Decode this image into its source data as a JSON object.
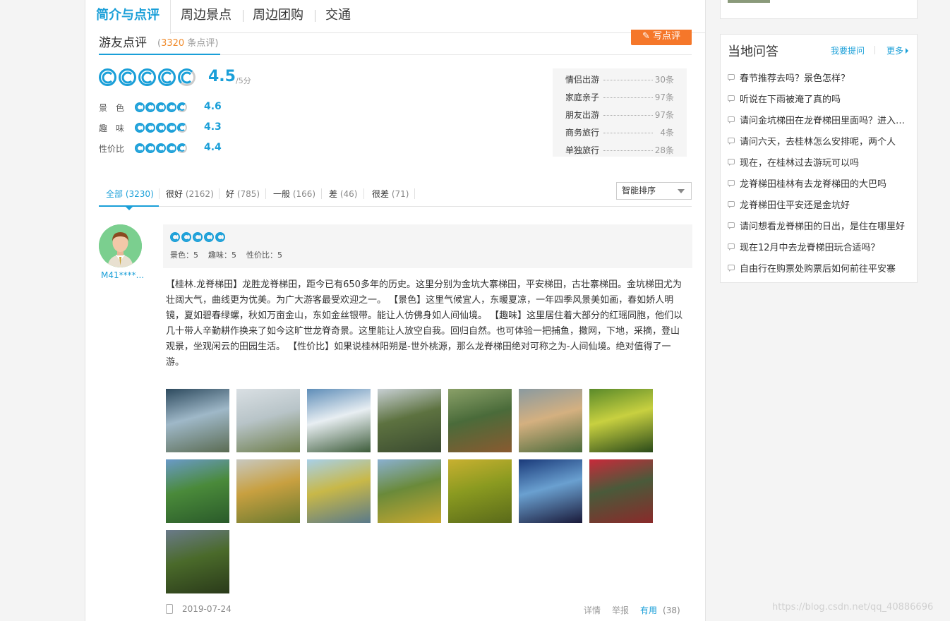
{
  "nav_tabs": [
    "简介与点评",
    "周边景点",
    "周边团购",
    "交通"
  ],
  "review_header": {
    "title": "游友点评",
    "count_open": "(",
    "count": "3320",
    "count_suffix": "条点评)",
    "write_button": "写点评"
  },
  "overall": {
    "score": "4.5",
    "unit": "/5分",
    "stars": 4.5
  },
  "sub_ratings": [
    {
      "label": "景　色",
      "score": "4.6"
    },
    {
      "label": "趣　味",
      "score": "4.3"
    },
    {
      "label": "性价比",
      "score": "4.4"
    }
  ],
  "trip_types": [
    {
      "label": "情侣出游",
      "count": "30条"
    },
    {
      "label": "家庭亲子",
      "count": "97条"
    },
    {
      "label": "朋友出游",
      "count": "97条"
    },
    {
      "label": "商务旅行",
      "count": "4条"
    },
    {
      "label": "单独旅行",
      "count": "28条"
    }
  ],
  "filters": [
    {
      "label": "全部",
      "count": "(3230)"
    },
    {
      "label": "很好",
      "count": "(2162)"
    },
    {
      "label": "好",
      "count": "(785)"
    },
    {
      "label": "一般",
      "count": "(166)"
    },
    {
      "label": "差",
      "count": "(46)"
    },
    {
      "label": "很差",
      "count": "(71)"
    }
  ],
  "sort": {
    "selected": "智能排序"
  },
  "review": {
    "user": "M41****...",
    "stars": 5,
    "detail": [
      "景色：5",
      "趣味：5",
      "性价比：5"
    ],
    "text": "【桂林.龙脊梯田】龙胜龙脊梯田，距今已有650多年的历史。这里分别为金坑大寨梯田，平安梯田，古壮寨梯田。金坑梯田尤为壮阔大气，曲线更为优美。为广大游客最受欢迎之一。 【景色】这里气候宜人，东暖夏凉，一年四季风景美如画，春如娇人明镜，夏如碧春绿螺，秋如万亩金山，东如金丝银带。能让人仿佛身如人间仙境。 【趣味】这里居住着大部分的红瑶同胞，他们以几十带人辛勤耕作换来了如今这旷世龙脊奇景。这里能让人放空自我。回归自然。也可体验一把捕鱼，撒网，下地，采摘，登山观景，坐观闲云的田园生活。 【性价比】如果说桂林阳朔是-世外桃源，那么龙脊梯田绝对可称之为-人间仙境。绝对值得了一游。",
    "date": "2019-07-24",
    "actions": {
      "detail": "详情",
      "report": "举报",
      "useful": "有用",
      "useful_count": "(38)"
    }
  },
  "photo_colors": [
    [
      "#2d4a5e",
      "#9fb8c8",
      "#5a6b52"
    ],
    [
      "#d9dfe3",
      "#b8c4c8",
      "#6d7d4a"
    ],
    [
      "#5e8db8",
      "#e8eef2",
      "#3d5c3a"
    ],
    [
      "#c8d0d4",
      "#5d7240",
      "#3a4a30"
    ],
    [
      "#8aa068",
      "#4a6b3a",
      "#8a5a30"
    ],
    [
      "#8a9aa0",
      "#d4b080",
      "#4a6a3a"
    ],
    [
      "#5a8a2a",
      "#c8d040",
      "#2a4a1a"
    ],
    [
      "#6a9ac8",
      "#4a8a3a",
      "#2a5a2a"
    ],
    [
      "#c8c8c0",
      "#c8a040",
      "#6a7a30"
    ],
    [
      "#a8d0e8",
      "#c8b848",
      "#5a7a8a"
    ],
    [
      "#8ab0d0",
      "#6a8a3a",
      "#c8a830"
    ],
    [
      "#c8b030",
      "#8a9a20",
      "#5a6a1a"
    ],
    [
      "#1a3a7a",
      "#6aa0d0",
      "#1a1a3a"
    ],
    [
      "#c82a3a",
      "#4a5a3a",
      "#8a2a2a"
    ],
    [
      "#6a7a8a",
      "#4a6a2a",
      "#2a3a1a"
    ]
  ],
  "qa": {
    "title": "当地问答",
    "ask": "我要提问",
    "more": "更多",
    "items": [
      "春节推荐去吗？景色怎样？",
      "听说在下雨被淹了真的吗",
      "请问金坑梯田在龙脊梯田里面吗？进入梯田需要收费吗",
      "请问六天，去桂林怎么安排呢，两个人",
      "现在，在桂林过去游玩可以吗",
      "龙脊梯田桂林有去龙脊梯田的大巴吗",
      "龙脊梯田住平安还是金坑好",
      "请问想看龙脊梯田的日出，是住在哪里好",
      "现在12月中去龙脊梯田玩合适吗？",
      "自由行在购票处购票后如何前往平安寨"
    ]
  },
  "watermark": "https://blog.csdn.net/qq_40886696"
}
